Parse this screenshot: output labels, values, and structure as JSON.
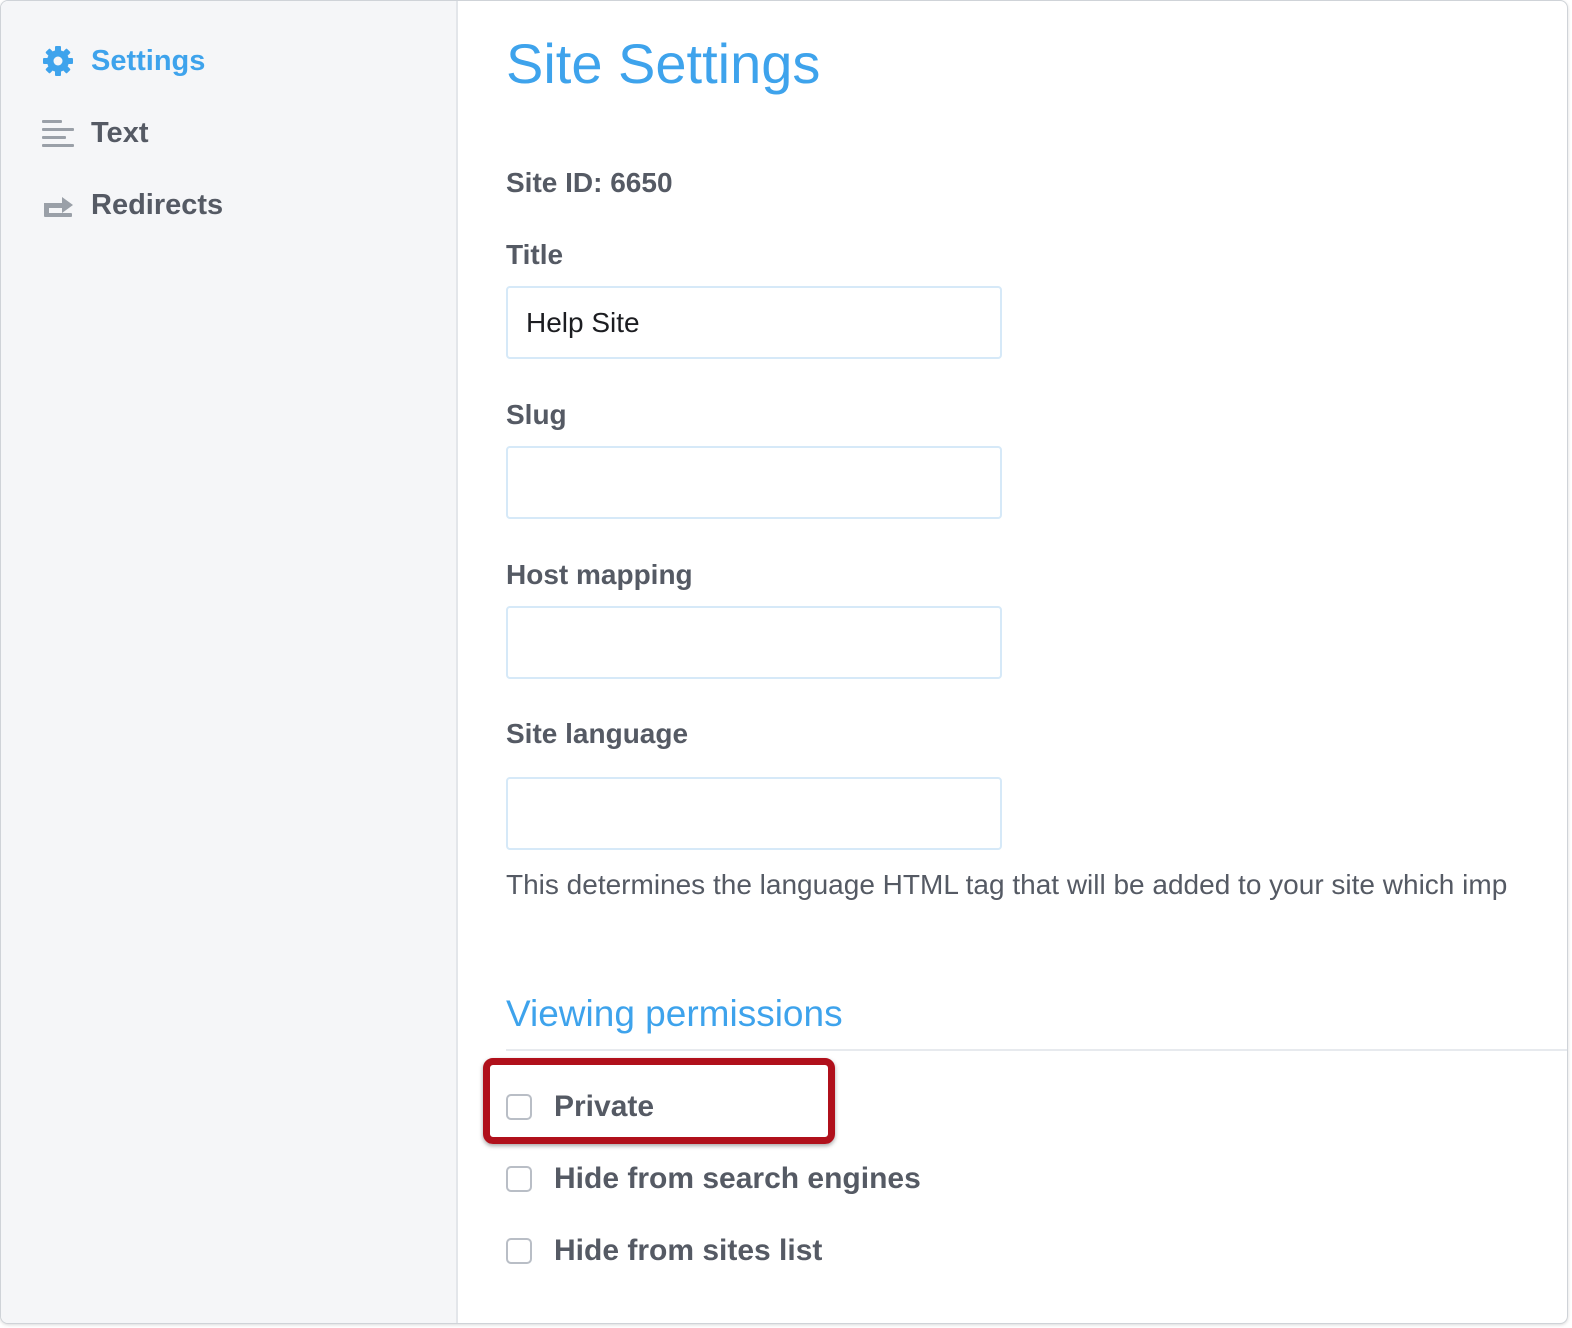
{
  "sidebar": {
    "items": [
      {
        "label": "Settings",
        "icon": "gear-icon",
        "active": true
      },
      {
        "label": "Text",
        "icon": "text-lines-icon",
        "active": false
      },
      {
        "label": "Redirects",
        "icon": "redirect-arrow-icon",
        "active": false
      }
    ]
  },
  "main": {
    "title": "Site Settings",
    "site_id": "Site ID: 6650",
    "fields": {
      "title": {
        "label": "Title",
        "value": "Help Site"
      },
      "slug": {
        "label": "Slug",
        "value": ""
      },
      "host_mapping": {
        "label": "Host mapping",
        "value": ""
      },
      "site_language": {
        "label": "Site language",
        "value": ""
      }
    },
    "language_help": "This determines the language HTML tag that will be added to your site which imp",
    "permissions": {
      "title": "Viewing permissions",
      "options": [
        {
          "label": "Private",
          "checked": false,
          "highlighted": true
        },
        {
          "label": "Hide from search engines",
          "checked": false
        },
        {
          "label": "Hide from sites list",
          "checked": false
        }
      ]
    }
  },
  "colors": {
    "accent": "#3ea3ec",
    "text": "#555a64",
    "highlight": "#b0101b",
    "sidebar_bg": "#f5f6f8"
  }
}
